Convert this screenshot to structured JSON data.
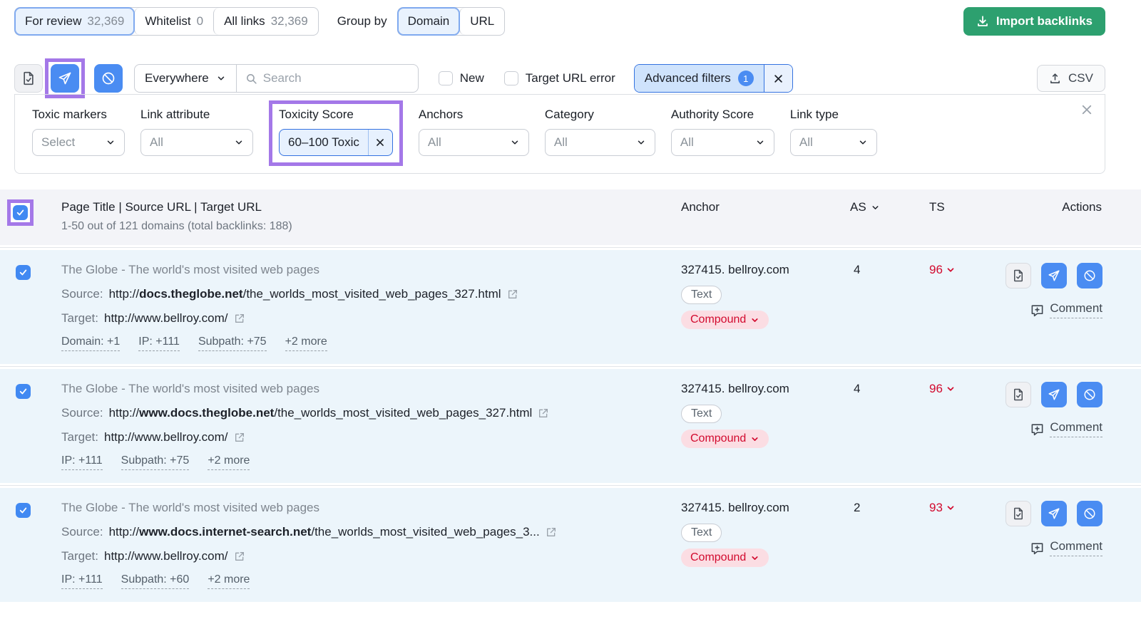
{
  "colors": {
    "accent_blue": "#4a8cf2",
    "highlight_purple": "#a478e8",
    "toxic_red": "#d20a2e",
    "success_green": "#2da06f",
    "row_bg": "#ecf5fb"
  },
  "topbar": {
    "tabs": [
      {
        "label": "For review",
        "count": "32,369",
        "active": true
      },
      {
        "label": "Whitelist",
        "count": "0",
        "active": false
      },
      {
        "label": "All links",
        "count": "32,369",
        "active": false
      }
    ],
    "group_by_label": "Group by",
    "group_toggle": [
      {
        "label": "Domain",
        "active": true
      },
      {
        "label": "URL",
        "active": false
      }
    ],
    "import_button_label": "Import backlinks"
  },
  "toolbar": {
    "move_buttons": [
      "whitelist-document",
      "send-to-remove",
      "block"
    ],
    "scope_value": "Everywhere",
    "search_placeholder": "Search",
    "new_checkbox_label": "New",
    "target_url_error_label": "Target URL error",
    "advanced_filters_label": "Advanced filters",
    "advanced_filters_badge": "1",
    "csv_label": "CSV"
  },
  "filters": {
    "toxic_markers": {
      "label": "Toxic markers",
      "value": "Select"
    },
    "link_attribute": {
      "label": "Link attribute",
      "value": "All"
    },
    "toxicity_score": {
      "label": "Toxicity Score",
      "value": "60–100 Toxic"
    },
    "anchors": {
      "label": "Anchors",
      "value": "All"
    },
    "category": {
      "label": "Category",
      "value": "All"
    },
    "authority_score": {
      "label": "Authority Score",
      "value": "All"
    },
    "link_type": {
      "label": "Link type",
      "value": "All"
    }
  },
  "table": {
    "header": {
      "title_col": "Page Title | Source URL | Target URL",
      "subtitle": "1-50 out of 121 domains (total backlinks: 188)",
      "anchor_col": "Anchor",
      "as_col": "AS",
      "ts_col": "TS",
      "actions_col": "Actions"
    },
    "rows": [
      {
        "title": "The Globe - The world's most visited web pages",
        "source_label": "Source:",
        "source_prefix": "http://",
        "source_domain": "docs.theglobe.net",
        "source_path": "/the_worlds_most_visited_web_pages_327.html",
        "target_label": "Target:",
        "target_url": "http://www.bellroy.com/",
        "markers": [
          "Domain: +1",
          "IP: +111",
          "Subpath: +75",
          "+2 more"
        ],
        "anchor": "327415. bellroy.com",
        "anchor_type": "Text",
        "anchor_tag": "Compound",
        "as": "4",
        "ts": "96",
        "comment_label": "Comment"
      },
      {
        "title": "The Globe - The world's most visited web pages",
        "source_label": "Source:",
        "source_prefix": "http://",
        "source_domain": "www.docs.theglobe.net",
        "source_path": "/the_worlds_most_visited_web_pages_327.html",
        "target_label": "Target:",
        "target_url": "http://www.bellroy.com/",
        "markers": [
          "IP: +111",
          "Subpath: +75",
          "+2 more"
        ],
        "anchor": "327415. bellroy.com",
        "anchor_type": "Text",
        "anchor_tag": "Compound",
        "as": "4",
        "ts": "96",
        "comment_label": "Comment"
      },
      {
        "title": "The Globe - The world's most visited web pages",
        "source_label": "Source:",
        "source_prefix": "http://",
        "source_domain": "www.docs.internet-search.net",
        "source_path": "/the_worlds_most_visited_web_pages_3...",
        "target_label": "Target:",
        "target_url": "http://www.bellroy.com/",
        "markers": [
          "IP: +111",
          "Subpath: +60",
          "+2 more"
        ],
        "anchor": "327415. bellroy.com",
        "anchor_type": "Text",
        "anchor_tag": "Compound",
        "as": "2",
        "ts": "93",
        "comment_label": "Comment"
      }
    ]
  }
}
